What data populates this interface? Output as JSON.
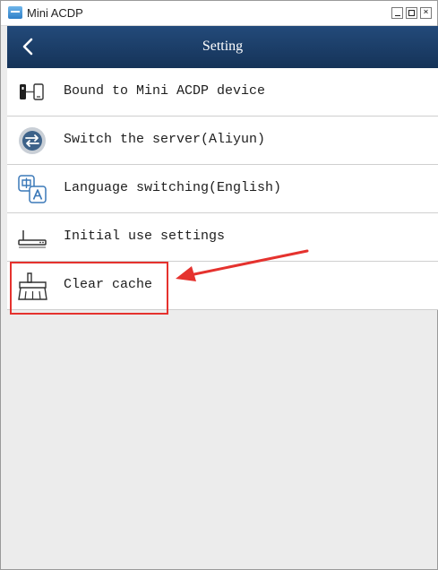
{
  "window": {
    "title": "Mini ACDP"
  },
  "navbar": {
    "title": "Setting"
  },
  "settings": {
    "items": [
      {
        "label": "Bound to Mini ACDP device",
        "icon": "device-link-icon"
      },
      {
        "label": "Switch the server(Aliyun)",
        "icon": "server-switch-icon"
      },
      {
        "label": "Language switching(English)",
        "icon": "language-icon"
      },
      {
        "label": "Initial use settings",
        "icon": "router-icon"
      },
      {
        "label": "Clear cache",
        "icon": "broom-icon"
      }
    ]
  },
  "colors": {
    "navbar": "#1b3d69",
    "highlight": "#e5322e",
    "background": "#ececec"
  }
}
